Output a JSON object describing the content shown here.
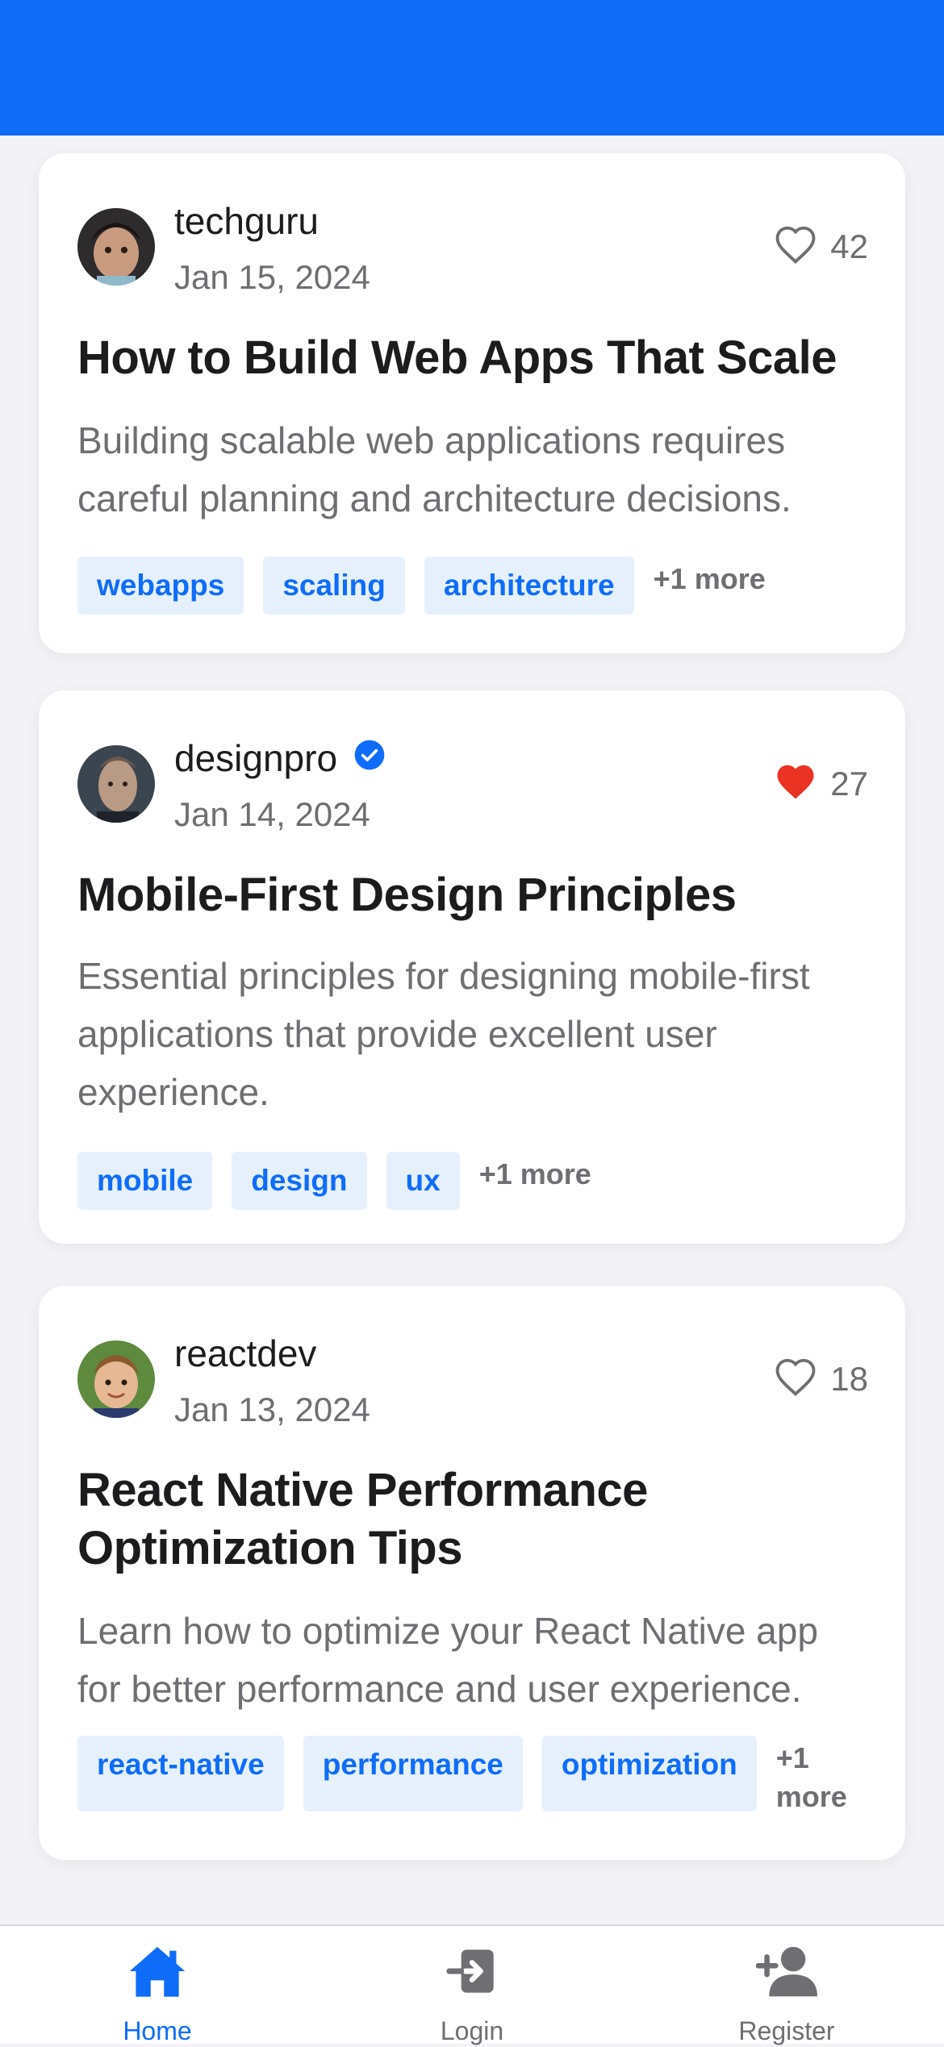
{
  "colors": {
    "accent": "#0e6cf9",
    "like_active": "#ea3323",
    "muted": "#6e6e73",
    "tag_bg": "#e6f0fd"
  },
  "posts": [
    {
      "author": "techguru",
      "verified": false,
      "date": "Jan 15, 2024",
      "likes": "42",
      "liked": false,
      "title": "How to Build Web Apps That Scale",
      "excerpt": "Building scalable web applications requires careful planning and architecture decisions.",
      "tags": [
        "webapps",
        "scaling",
        "architecture"
      ],
      "more": "+1 more"
    },
    {
      "author": "designpro",
      "verified": true,
      "date": "Jan 14, 2024",
      "likes": "27",
      "liked": true,
      "title": "Mobile-First Design Principles",
      "excerpt": "Essential principles for designing mobile-first applications that provide excellent user experience.",
      "tags": [
        "mobile",
        "design",
        "ux"
      ],
      "more": "+1 more"
    },
    {
      "author": "reactdev",
      "verified": false,
      "date": "Jan 13, 2024",
      "likes": "18",
      "liked": false,
      "title": "React Native Performance Optimization Tips",
      "excerpt": "Learn how to optimize your React Native app for better performance and user experience.",
      "tags": [
        "react-native",
        "performance",
        "optimization"
      ],
      "more": "+1 more"
    }
  ],
  "tabbar": {
    "tabs": [
      {
        "label": "Home",
        "icon": "home-icon",
        "active": true
      },
      {
        "label": "Login",
        "icon": "login-icon",
        "active": false
      },
      {
        "label": "Register",
        "icon": "add-user-icon",
        "active": false
      }
    ]
  }
}
